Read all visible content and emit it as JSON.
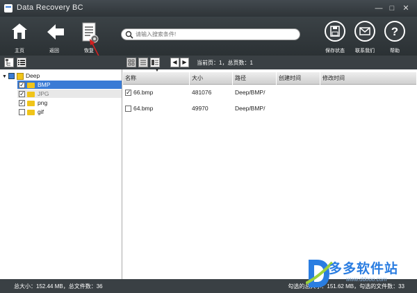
{
  "window": {
    "title": "Data Recovery BC",
    "minimize": "—",
    "maximize": "□",
    "close": "✕"
  },
  "toolbar": {
    "home_label": "主页",
    "back_label": "返回",
    "recover_label": "恢复",
    "save_status_label": "保存状态",
    "contact_label": "联系我们",
    "help_label": "帮助"
  },
  "search": {
    "placeholder": "请输入搜索条件!"
  },
  "nav": {
    "prev": "◀",
    "next": "▶",
    "page_info": "当前页：1，总页数：1"
  },
  "tree": {
    "root": "Deep",
    "children": [
      {
        "label": "BMP",
        "checked": true,
        "selected": true
      },
      {
        "label": "JPG",
        "checked": true,
        "selected": false
      },
      {
        "label": "png",
        "checked": true,
        "selected": false
      },
      {
        "label": "gif",
        "checked": false,
        "selected": false
      }
    ]
  },
  "table": {
    "columns": [
      "名称",
      "大小",
      "路径",
      "创建时间",
      "修改时间"
    ],
    "rows": [
      {
        "checked": true,
        "name": "66.bmp",
        "size": "481076",
        "path": "Deep/BMP/",
        "created": "",
        "modified": ""
      },
      {
        "checked": false,
        "name": "64.bmp",
        "size": "49970",
        "path": "Deep/BMP/",
        "created": "",
        "modified": ""
      }
    ]
  },
  "status": {
    "left": "总大小：152.44 MB，总文件数：36",
    "right": "勾选的总大小：151.62 MB，勾选的文件数：33"
  },
  "watermark": {
    "text": "多多软件站",
    "sub": "www.ddooo.com"
  },
  "colors": {
    "accent": "#3a7bd5",
    "titlebar": "#2e3438",
    "folder": "#f0c419",
    "arrow": "#d32020",
    "selection": "#3a7bd5"
  }
}
